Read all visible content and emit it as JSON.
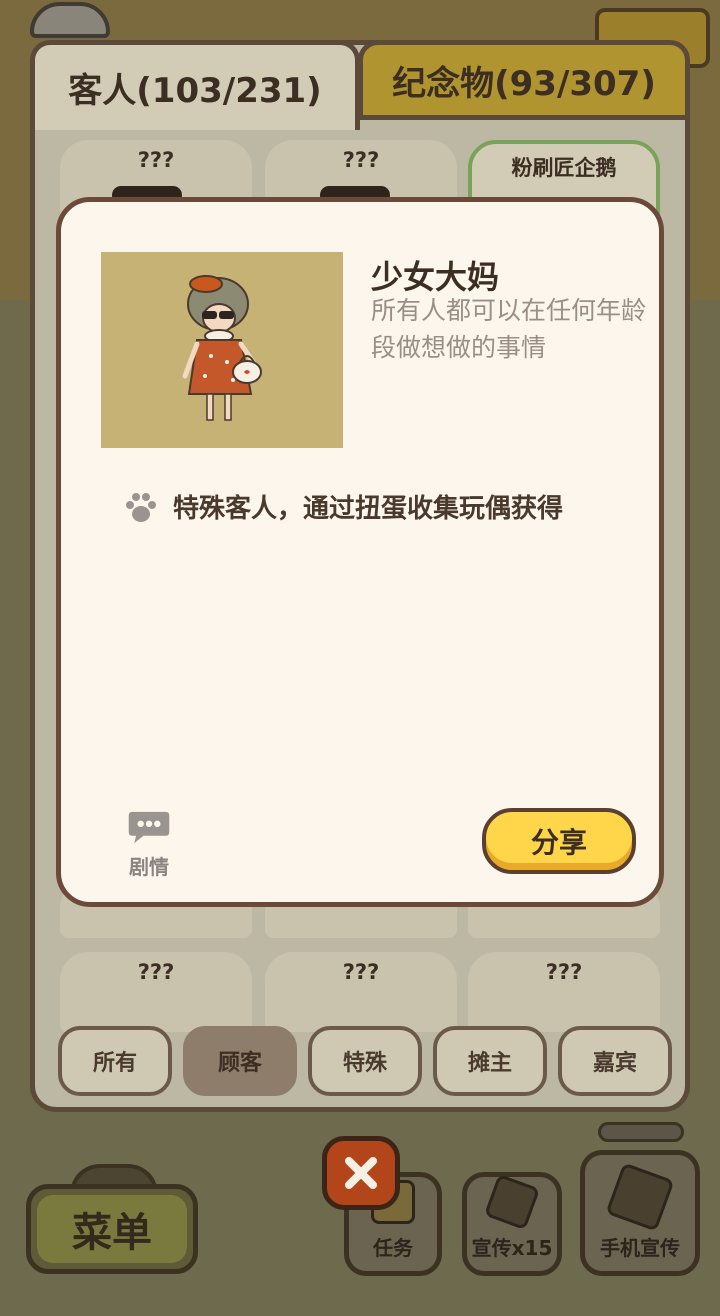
{
  "tabs": [
    {
      "label": "客人(103/231)"
    },
    {
      "label": "纪念物(93/307)"
    }
  ],
  "grid_cards": [
    {
      "label": "???"
    },
    {
      "label": "???"
    },
    {
      "label": "粉刷匠企鹅"
    },
    {
      "label": "???"
    },
    {
      "label": "???"
    },
    {
      "label": "???"
    }
  ],
  "filters": [
    {
      "label": "所有"
    },
    {
      "label": "顾客"
    },
    {
      "label": "特殊"
    },
    {
      "label": "摊主"
    },
    {
      "label": "嘉宾"
    }
  ],
  "filter_selected": "顾客",
  "modal": {
    "name": "少女大妈",
    "description": "所有人都可以在任何年龄段做想做的事情",
    "obtain_text": "特殊客人，通过扭蛋收集玩偶获得",
    "story_label": "剧情",
    "share_label": "分享",
    "icons": {
      "obtain": "paw-icon",
      "story": "speech-bubble-icon"
    }
  },
  "hud": {
    "menu_label": "菜单",
    "task_label": "任务",
    "promo_label": "宣传x15",
    "phone_promo_label": "手机宣传",
    "close_icon": "close-icon"
  },
  "colors": {
    "accent_yellow": "#ffd54a",
    "modal_bg": "#fdf6ec",
    "tab_inactive": "#b0942f",
    "close_red": "#b2461a"
  }
}
